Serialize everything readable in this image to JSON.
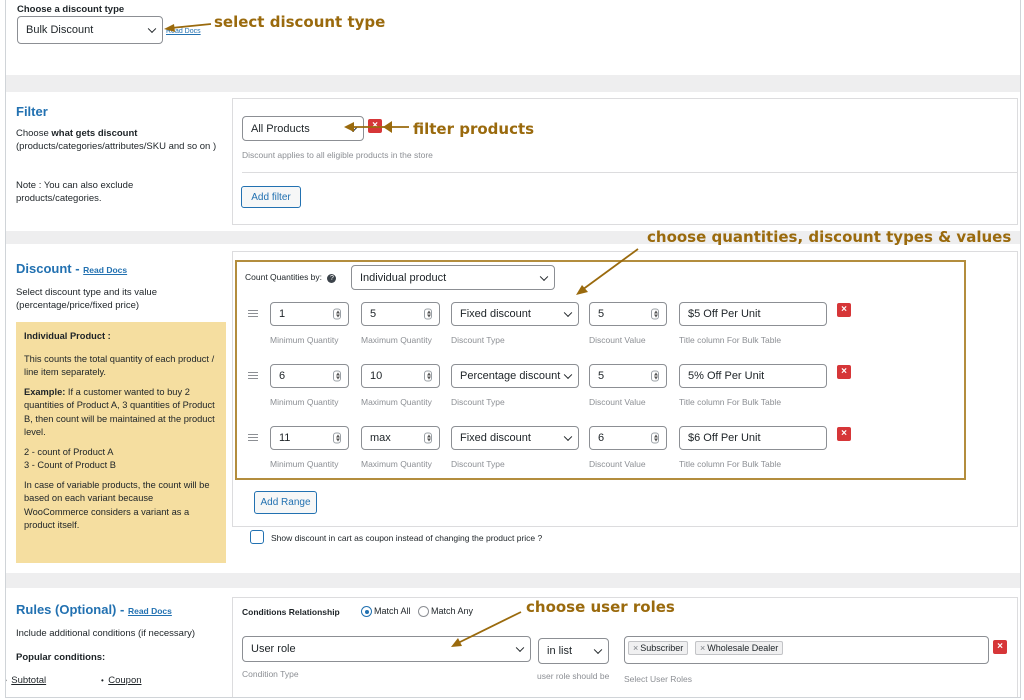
{
  "colors": {
    "accent": "#2271b1",
    "annotation": "#9a6a0d",
    "remove": "#d63638",
    "note_bg": "#f5dea0"
  },
  "discount_type": {
    "label": "Choose a discount type",
    "selected": "Bulk Discount",
    "read_docs": "Read Docs",
    "annotation": "select discount type"
  },
  "filter": {
    "title": "Filter",
    "desc_prefix": "Choose ",
    "desc_bold": "what gets discount",
    "desc_rest": "(products/categories/attributes/SKU and so on )",
    "note": "Note : You can also exclude products/categories.",
    "selected": "All Products",
    "help": "Discount applies to all eligible products in the store",
    "add_button": "Add filter",
    "annotation": "filter products"
  },
  "discount": {
    "title": "Discount - ",
    "read_docs": "Read Docs",
    "desc": "Select discount type and its value (percentage/price/fixed price)",
    "note": {
      "heading": "Individual Product :",
      "p1": "This counts the total quantity of each product / line item separately.",
      "example_label": "Example:",
      "example_text": " If a customer wanted to buy 2 quantities of Product A, 3 quantities of Product B, then count will be maintained at the product level.",
      "line1": "2 - count of Product A",
      "line2": "3 - Count of Product B",
      "p3": "In case of variable products, the count will be based on each variant because WooCommerce considers a variant as a product itself."
    },
    "count_by_label": "Count Quantities by:",
    "help_icon": "?",
    "count_by_value": "Individual product",
    "annotation": "choose quantities, discount types & values",
    "captions": {
      "min": "Minimum Quantity",
      "max": "Maximum Quantity",
      "type": "Discount Type",
      "value": "Discount Value",
      "title": "Title column For Bulk Table"
    },
    "ranges": [
      {
        "min": "1",
        "max": "5",
        "type": "Fixed discount",
        "value": "5",
        "title": "$5 Off Per Unit"
      },
      {
        "min": "6",
        "max": "10",
        "type": "Percentage discount",
        "value": "5",
        "title": "5% Off Per Unit"
      },
      {
        "min": "11",
        "max": "max",
        "type": "Fixed discount",
        "value": "6",
        "title": "$6 Off Per Unit"
      }
    ],
    "add_range": "Add Range",
    "coupon_label": "Show discount in cart as coupon instead of changing the product price ?",
    "remove_symbol": "×"
  },
  "rules": {
    "title": "Rules (Optional) - ",
    "read_docs": "Read Docs",
    "desc": "Include additional conditions (if necessary)",
    "popular": "Popular conditions:",
    "items": [
      "Subtotal",
      "Coupon"
    ],
    "relationship_label": "Conditions Relationship",
    "match_all": "Match All",
    "match_any": "Match Any",
    "condition_type": "User role",
    "condition_type_caption": "Condition Type",
    "operator": "in list",
    "operator_caption": "user role should be",
    "roles": [
      "Subscriber",
      "Wholesale Dealer"
    ],
    "roles_caption": "Select User Roles",
    "annotation": "choose user roles",
    "tag_remove": "×"
  }
}
